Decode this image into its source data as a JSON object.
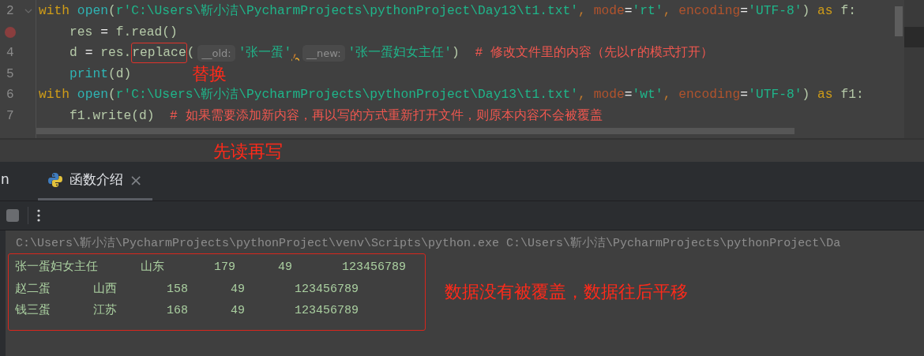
{
  "editor": {
    "lines": [
      {
        "number": "2",
        "foldable": true,
        "tokens": [
          {
            "kind": "keyword",
            "text": "with"
          },
          {
            "kind": "builtin",
            "text": " open"
          },
          {
            "kind": "plain",
            "text": "("
          },
          {
            "kind": "string",
            "text": "r'C:\\Users\\靳小洁\\PycharmProjects\\pythonProject\\Day13\\t1.txt'"
          },
          {
            "kind": "punct",
            "text": ", "
          },
          {
            "kind": "param",
            "text": "mode"
          },
          {
            "kind": "op",
            "text": "="
          },
          {
            "kind": "string",
            "text": "'rt'"
          },
          {
            "kind": "punct",
            "text": ", "
          },
          {
            "kind": "param",
            "text": "encoding"
          },
          {
            "kind": "op",
            "text": "="
          },
          {
            "kind": "string",
            "text": "'UTF-8'"
          },
          {
            "kind": "plain",
            "text": ") "
          },
          {
            "kind": "keyword",
            "text": "as"
          },
          {
            "kind": "plain",
            "text": " f:"
          }
        ]
      },
      {
        "breakpoint": true,
        "indented": true,
        "tokens": [
          {
            "kind": "plain",
            "text": "res "
          },
          {
            "kind": "op",
            "text": "="
          },
          {
            "kind": "plain",
            "text": " f.read()"
          }
        ]
      },
      {
        "number": "4",
        "indented": true,
        "tokens": [
          {
            "kind": "plain",
            "text": "d "
          },
          {
            "kind": "op",
            "text": "="
          },
          {
            "kind": "plain",
            "text": " res."
          },
          {
            "kind": "plain",
            "text": "replace",
            "boxed": true
          },
          {
            "kind": "plain",
            "text": "("
          },
          {
            "kind": "hint",
            "text": "__old:"
          },
          {
            "kind": "string",
            "text": "'张一蛋'"
          },
          {
            "kind": "punct",
            "text": ",",
            "warning": true
          },
          {
            "kind": "hint",
            "text": "__new:"
          },
          {
            "kind": "string",
            "text": "'张一蛋妇女主任'"
          },
          {
            "kind": "plain",
            "text": ")  "
          },
          {
            "kind": "comment",
            "text": "# 修改文件里的内容（先以r的模式打开）"
          }
        ]
      },
      {
        "number": "5",
        "indented": true,
        "note": "替换",
        "tokens": [
          {
            "kind": "builtin",
            "text": "print"
          },
          {
            "kind": "plain",
            "text": "(d)"
          }
        ]
      },
      {
        "number": "6",
        "tokens": [
          {
            "kind": "keyword",
            "text": "with"
          },
          {
            "kind": "builtin",
            "text": " open"
          },
          {
            "kind": "plain",
            "text": "("
          },
          {
            "kind": "string",
            "text": "r'C:\\Users\\靳小洁\\PycharmProjects\\pythonProject\\Day13\\t1.txt'"
          },
          {
            "kind": "punct",
            "text": ", "
          },
          {
            "kind": "param",
            "text": "mode"
          },
          {
            "kind": "op",
            "text": "="
          },
          {
            "kind": "string",
            "text": "'wt'"
          },
          {
            "kind": "punct",
            "text": ", "
          },
          {
            "kind": "param",
            "text": "encoding"
          },
          {
            "kind": "op",
            "text": "="
          },
          {
            "kind": "string",
            "text": "'UTF-8'"
          },
          {
            "kind": "plain",
            "text": ") "
          },
          {
            "kind": "keyword",
            "text": "as"
          },
          {
            "kind": "plain",
            "text": " f1:"
          }
        ]
      },
      {
        "number": "7",
        "indented": true,
        "tokens": [
          {
            "kind": "plain",
            "text": "f1.write(d)  "
          },
          {
            "kind": "comment",
            "text": "# 如果需要添加新内容，再以写的方式重新打开文件，则原本内容不会被覆盖"
          }
        ]
      }
    ]
  },
  "note_bar": "先读再写",
  "tabs": [
    {
      "label": "n",
      "selected": false
    },
    {
      "label": "函数介绍",
      "selected": true,
      "icon": true,
      "closable": true
    }
  ],
  "close_glyph": "×",
  "console": {
    "command": "C:\\Users\\靳小洁\\PycharmProjects\\pythonProject\\venv\\Scripts\\python.exe C:\\Users\\靳小洁\\PycharmProjects\\pythonProject\\Da",
    "output_boxed": true,
    "output": [
      "张一蛋妇女主任      山东       179      49       123456789",
      "赵二蛋      山西       158      49       123456789",
      "钱三蛋      江苏       168      49       123456789"
    ],
    "note": "数据没有被覆盖，数据往后平移"
  }
}
